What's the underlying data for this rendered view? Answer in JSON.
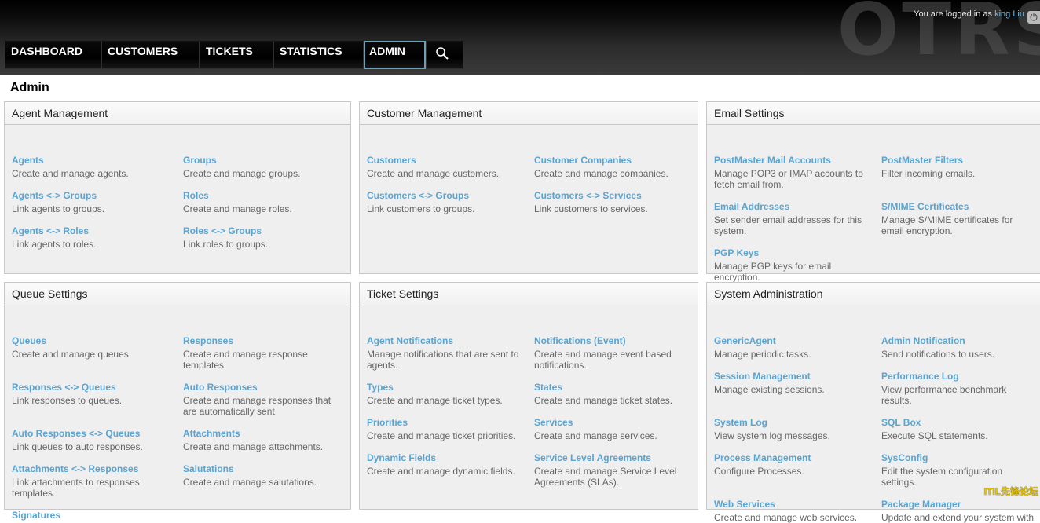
{
  "header": {
    "logo_text": "OTRS",
    "login_prefix": "You are logged in as ",
    "login_user": "king Liu",
    "nav": [
      {
        "label": "DASHBOARD"
      },
      {
        "label": "CUSTOMERS"
      },
      {
        "label": "TICKETS"
      },
      {
        "label": "STATISTICS"
      },
      {
        "label": "ADMIN",
        "selected": true
      }
    ],
    "search_icon": "search-icon",
    "logout_icon": "power-icon"
  },
  "page": {
    "title": "Admin"
  },
  "sections": [
    {
      "title": "Agent Management",
      "items": [
        {
          "link": "Agents",
          "desc": "Create and manage agents."
        },
        {
          "link": "Groups",
          "desc": "Create and manage groups."
        },
        {
          "link": "Agents <-> Groups",
          "desc": "Link agents to groups."
        },
        {
          "link": "Roles",
          "desc": "Create and manage roles."
        },
        {
          "link": "Agents <-> Roles",
          "desc": "Link agents to roles."
        },
        {
          "link": "Roles <-> Groups",
          "desc": "Link roles to groups."
        }
      ]
    },
    {
      "title": "Customer Management",
      "items": [
        {
          "link": "Customers",
          "desc": "Create and manage customers."
        },
        {
          "link": "Customer Companies",
          "desc": "Create and manage companies."
        },
        {
          "link": "Customers <-> Groups",
          "desc": "Link customers to groups."
        },
        {
          "link": "Customers <-> Services",
          "desc": "Link customers to services."
        }
      ]
    },
    {
      "title": "Email Settings",
      "items": [
        {
          "link": "PostMaster Mail Accounts",
          "desc": "Manage POP3 or IMAP accounts to fetch email from."
        },
        {
          "link": "PostMaster Filters",
          "desc": "Filter incoming emails."
        },
        {
          "link": "Email Addresses",
          "desc": "Set sender email addresses for this system."
        },
        {
          "link": "S/MIME Certificates",
          "desc": "Manage S/MIME certificates for email encryption."
        },
        {
          "link": "PGP Keys",
          "desc": "Manage PGP keys for email encryption."
        }
      ]
    },
    {
      "title": "Queue Settings",
      "items": [
        {
          "link": "Queues",
          "desc": "Create and manage queues."
        },
        {
          "link": "Responses",
          "desc": "Create and manage response templates."
        },
        {
          "link": "Responses <-> Queues",
          "desc": "Link responses to queues."
        },
        {
          "link": "Auto Responses",
          "desc": "Create and manage responses that are automatically sent."
        },
        {
          "link": "Auto Responses <-> Queues",
          "desc": "Link queues to auto responses."
        },
        {
          "link": "Attachments",
          "desc": "Create and manage attachments."
        },
        {
          "link": "Attachments <-> Responses",
          "desc": "Link attachments to responses templates."
        },
        {
          "link": "Salutations",
          "desc": "Create and manage salutations."
        },
        {
          "link": "Signatures",
          "desc": ""
        }
      ]
    },
    {
      "title": "Ticket Settings",
      "items": [
        {
          "link": "Agent Notifications",
          "desc": "Manage notifications that are sent to agents."
        },
        {
          "link": "Notifications (Event)",
          "desc": "Create and manage event based notifications."
        },
        {
          "link": "Types",
          "desc": "Create and manage ticket types."
        },
        {
          "link": "States",
          "desc": "Create and manage ticket states."
        },
        {
          "link": "Priorities",
          "desc": "Create and manage ticket priorities."
        },
        {
          "link": "Services",
          "desc": "Create and manage services."
        },
        {
          "link": "Dynamic Fields",
          "desc": "Create and manage dynamic fields."
        },
        {
          "link": "Service Level Agreements",
          "desc": "Create and manage Service Level Agreements (SLAs)."
        }
      ]
    },
    {
      "title": "System Administration",
      "items": [
        {
          "link": "GenericAgent",
          "desc": "Manage periodic tasks."
        },
        {
          "link": "Admin Notification",
          "desc": "Send notifications to users."
        },
        {
          "link": "Session Management",
          "desc": "Manage existing sessions."
        },
        {
          "link": "Performance Log",
          "desc": "View performance benchmark results."
        },
        {
          "link": "System Log",
          "desc": "View system log messages."
        },
        {
          "link": "SQL Box",
          "desc": "Execute SQL statements."
        },
        {
          "link": "Process Management",
          "desc": "Configure Processes."
        },
        {
          "link": "SysConfig",
          "desc": "Edit the system configuration settings."
        },
        {
          "link": "Web Services",
          "desc": "Create and manage web services."
        },
        {
          "link": "Package Manager",
          "desc": "Update and extend your system with"
        }
      ]
    }
  ],
  "watermark": "ITIL先锋论坛"
}
